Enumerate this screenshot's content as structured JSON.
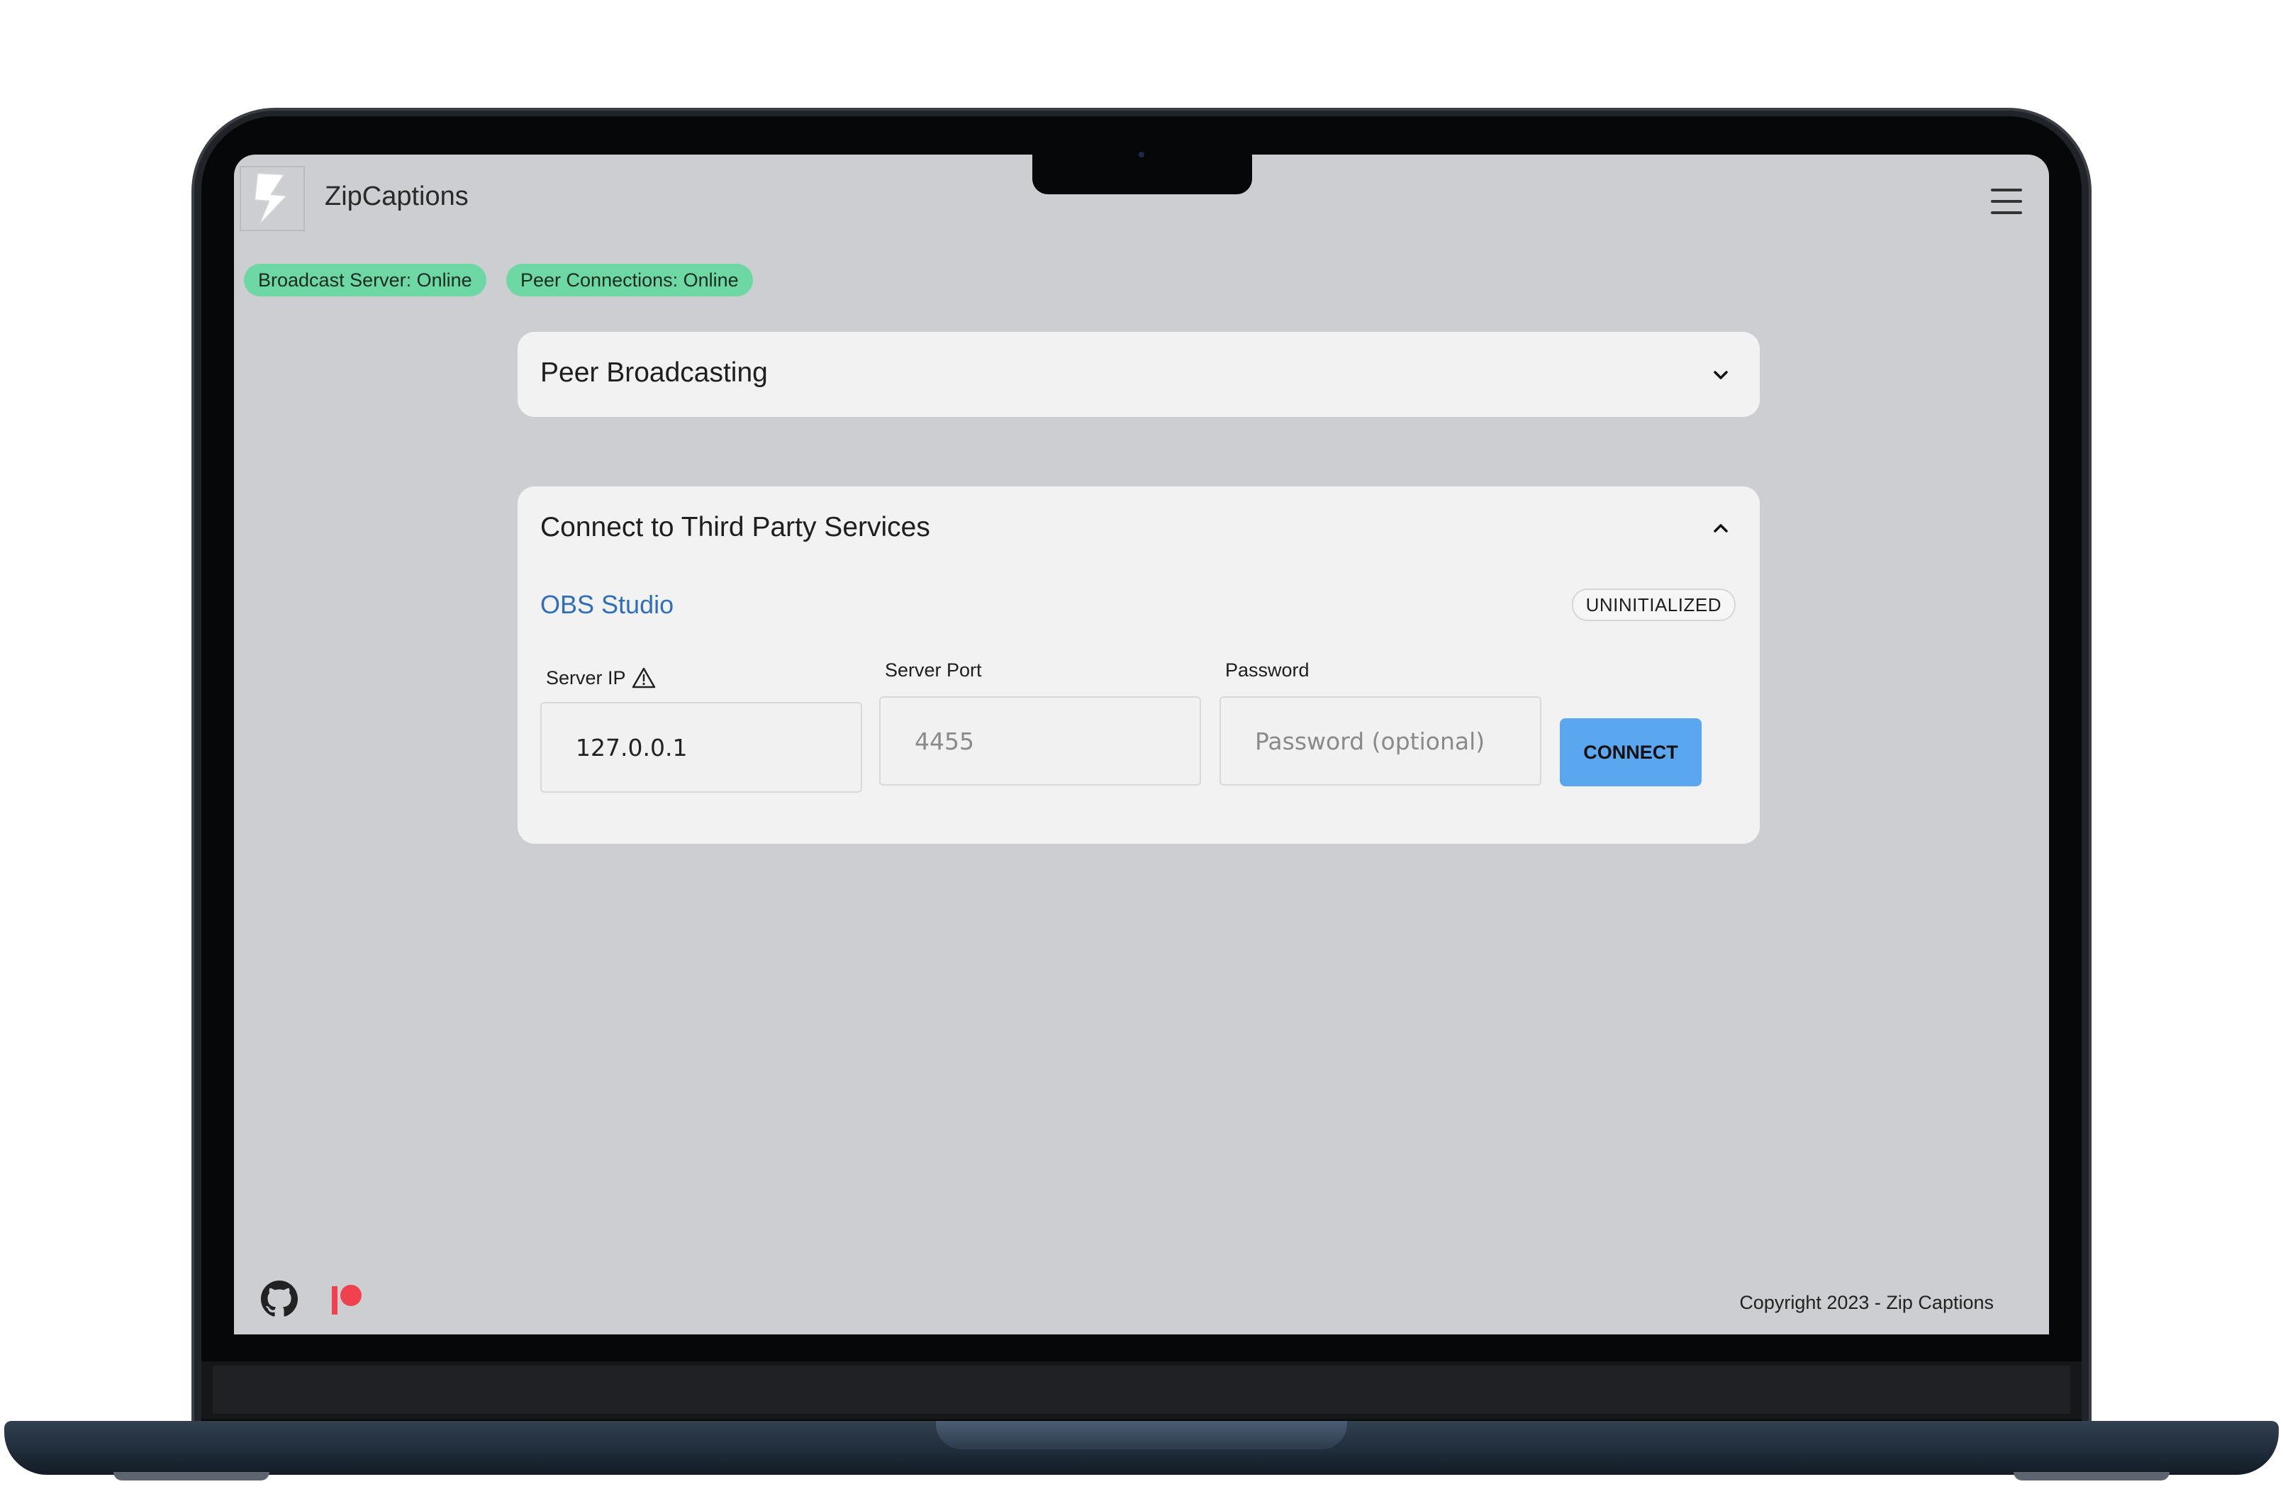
{
  "app": {
    "title": "ZipCaptions",
    "logo_icon": "lightning-bolt-icon",
    "menu_icon": "hamburger-menu-icon"
  },
  "status_badges": [
    {
      "label": "Broadcast Server: Online",
      "color": "#6ed8a5"
    },
    {
      "label": "Peer Connections: Online",
      "color": "#6ed8a5"
    }
  ],
  "peer_broadcasting": {
    "title": "Peer Broadcasting",
    "expanded": false,
    "toggle_icon": "chevron-down-icon"
  },
  "third_party": {
    "title": "Connect to Third Party Services",
    "expanded": true,
    "toggle_icon": "chevron-up-icon",
    "obs": {
      "name": "OBS Studio",
      "status": "UNINITIALIZED",
      "server_ip": {
        "label": "Server IP",
        "value": "127.0.0.1",
        "warning_icon": "warning-triangle-icon"
      },
      "server_port": {
        "label": "Server Port",
        "placeholder": "4455"
      },
      "password": {
        "label": "Password",
        "placeholder": "Password (optional)"
      },
      "connect_label": "CONNECT"
    }
  },
  "footer": {
    "links": [
      {
        "icon": "github-icon"
      },
      {
        "icon": "patreon-icon"
      }
    ],
    "copyright": "Copyright 2023 - Zip Captions"
  },
  "colors": {
    "screen_bg": "#cdced2",
    "card_bg": "#f2f2f2",
    "badge_green": "#6ed8a5",
    "link_blue": "#2f6fba",
    "button_blue": "#5aa6ef",
    "patreon_red": "#f0414f"
  }
}
